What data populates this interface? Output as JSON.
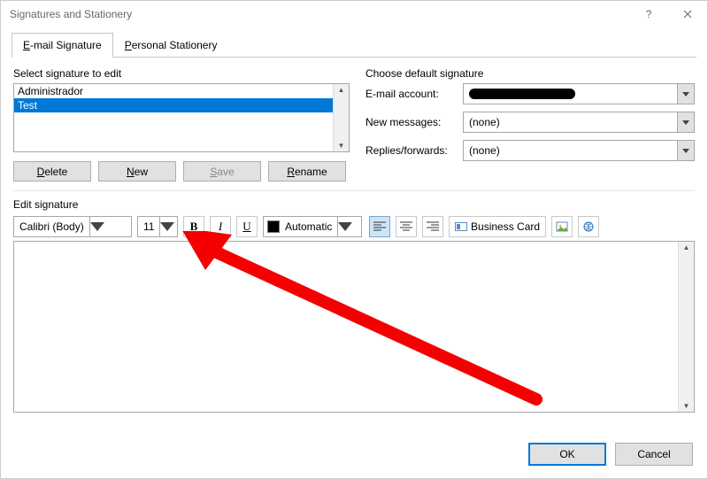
{
  "window": {
    "title": "Signatures and Stationery"
  },
  "tabs": {
    "email": "E-mail Signature",
    "personal": "Personal Stationery",
    "email_ul": "E",
    "personal_ul": "P"
  },
  "leftPanel": {
    "selectLabel": "Select signature to edit",
    "items": [
      "Administrador",
      "Test"
    ],
    "buttons": {
      "delete": "Delete",
      "new": "New",
      "save": "Save",
      "rename": "Rename",
      "delete_ul": "D",
      "new_ul": "N",
      "save_ul": "S",
      "rename_ul": "R"
    }
  },
  "rightPanel": {
    "header": "Choose default signature",
    "email_account": "E-mail account:",
    "new_messages": "New messages:",
    "replies_forwards": "Replies/forwards:",
    "new_messages_val": "(none)",
    "replies_forwards_val": "(none)"
  },
  "editor": {
    "label": "Edit signature",
    "font": "Calibri (Body)",
    "size": "11",
    "color_label": "Automatic",
    "business_card": "Business Card",
    "business_card_ul": "B"
  },
  "footer": {
    "ok": "OK",
    "cancel": "Cancel"
  }
}
